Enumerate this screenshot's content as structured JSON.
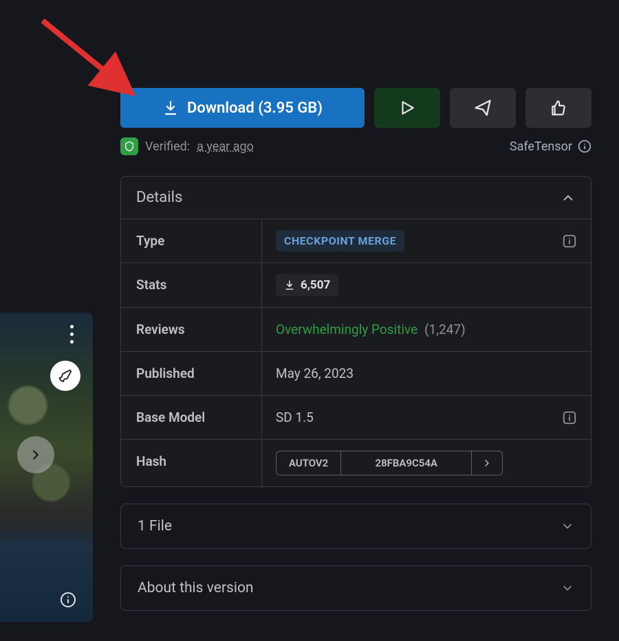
{
  "download": {
    "label": "Download (3.95 GB)"
  },
  "verified": {
    "prefix": "Verified:",
    "time": "a year ago"
  },
  "format_tag": "SafeTensor",
  "details": {
    "title": "Details",
    "rows": {
      "type": {
        "label": "Type",
        "badge": "CHECKPOINT MERGE"
      },
      "stats": {
        "label": "Stats",
        "value": "6,507"
      },
      "reviews": {
        "label": "Reviews",
        "rating": "Overwhelmingly Positive",
        "count": "(1,247)"
      },
      "published": {
        "label": "Published",
        "value": "May 26, 2023"
      },
      "base": {
        "label": "Base Model",
        "value": "SD 1.5"
      },
      "hash": {
        "label": "Hash",
        "algo": "AUTOV2",
        "value": "28FBA9C54A"
      }
    }
  },
  "files_panel": "1 File",
  "about_panel": "About this version"
}
